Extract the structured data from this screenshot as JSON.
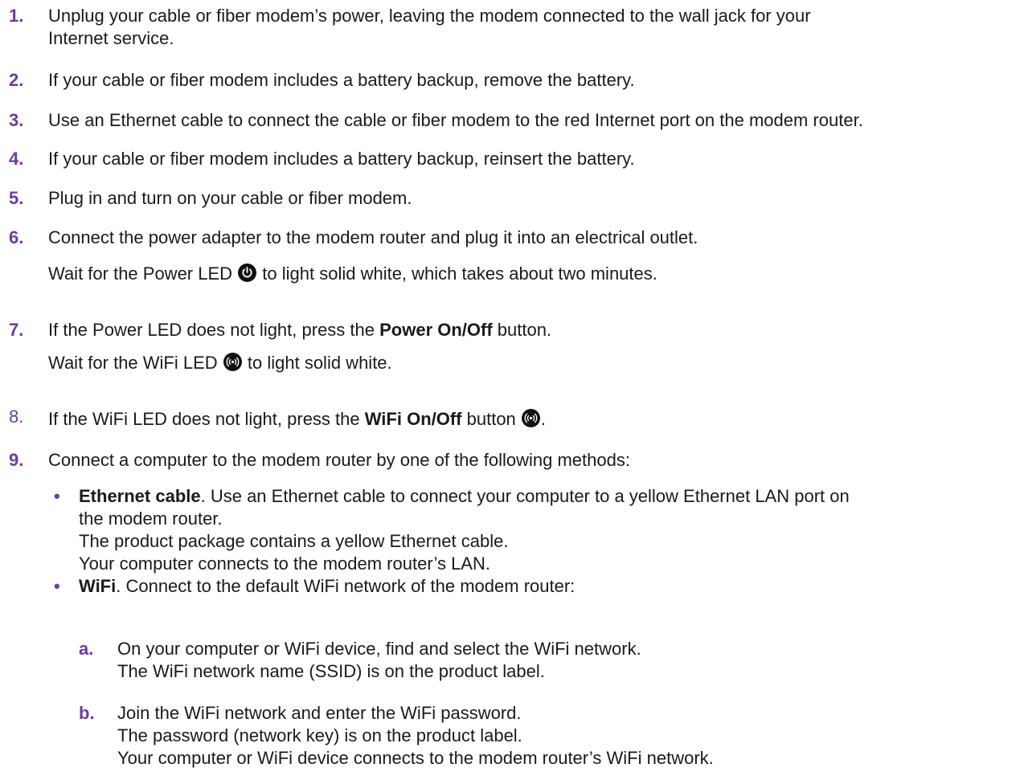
{
  "steps": [
    {
      "num": "1.",
      "line1": "Unplug your cable or fiber modem’s power, leaving the modem connected to the wall jack for your",
      "line2": "Internet service."
    },
    {
      "num": "2.",
      "text": "If your cable or fiber modem includes a battery backup, remove the battery."
    },
    {
      "num": "3.",
      "text": "Use an Ethernet cable to connect the cable or fiber modem to the red Internet port on the modem router."
    },
    {
      "num": "4.",
      "text": "If your cable or fiber modem includes a battery backup, reinsert the battery."
    },
    {
      "num": "5.",
      "text": "Plug in and turn on your cable or fiber modem."
    },
    {
      "num": "6.",
      "text": "Connect the power adapter to the modem router and plug it into an electrical outlet.",
      "sub_before": "Wait for the Power LED ",
      "sub_after": " to light solid white, which takes about two minutes."
    },
    {
      "num": "7.",
      "before": "If the Power LED does not light, press the ",
      "bold": "Power On/Off",
      "after": " button.",
      "sub_before": "Wait for the WiFi LED ",
      "sub_after": " to light solid white."
    },
    {
      "num": "8.",
      "before": "If the WiFi LED does not light, press the ",
      "bold": "WiFi On/Off",
      "after": " button ",
      "end": "."
    },
    {
      "num": "9.",
      "text": "Connect a computer to the modem router by one of the following methods:"
    }
  ],
  "bullets": [
    {
      "dot": "•",
      "bold": "Ethernet cable",
      "line1": ". Use an Ethernet cable to connect your computer to a yellow Ethernet LAN port on",
      "line2": "the modem router.",
      "line3": "The product package contains a yellow Ethernet cable.",
      "line4": "Your computer connects to the modem router’s LAN."
    },
    {
      "dot": "•",
      "bold": "WiFi",
      "line1": ". Connect to the default WiFi network of the modem router:"
    }
  ],
  "substeps": [
    {
      "letter": "a.",
      "line1": "On your computer or WiFi device, find and select the WiFi network.",
      "line2": "The WiFi network name (SSID) is on the product label."
    },
    {
      "letter": "b.",
      "line1": "Join the WiFi network and enter the WiFi password.",
      "line2": "The password (network key) is on the product label.",
      "line3": "Your computer or WiFi device connects to the modem router’s WiFi network."
    }
  ],
  "icons": {
    "power": "power-led-icon",
    "wifi": "wifi-led-icon"
  },
  "colors": {
    "accent": "#6e3a9e",
    "text": "#1a1a1a",
    "icon": "#111111"
  }
}
